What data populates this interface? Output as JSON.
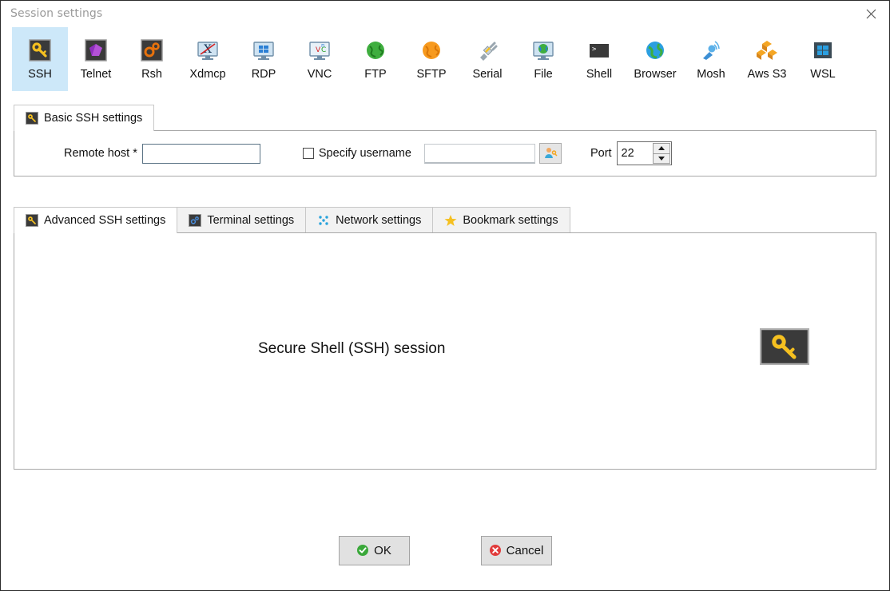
{
  "window": {
    "title": "Session settings",
    "close_label": "Close",
    "close_icon": "close-icon"
  },
  "session_types": [
    {
      "id": "ssh",
      "label": "SSH",
      "icon": "ssh-key-icon",
      "selected": true
    },
    {
      "id": "telnet",
      "label": "Telnet",
      "icon": "telnet-gem-icon",
      "selected": false
    },
    {
      "id": "rsh",
      "label": "Rsh",
      "icon": "rsh-gears-icon",
      "selected": false
    },
    {
      "id": "xdmcp",
      "label": "Xdmcp",
      "icon": "xdmcp-monitor-icon",
      "selected": false
    },
    {
      "id": "rdp",
      "label": "RDP",
      "icon": "rdp-windows-icon",
      "selected": false
    },
    {
      "id": "vnc",
      "label": "VNC",
      "icon": "vnc-monitor-icon",
      "selected": false
    },
    {
      "id": "ftp",
      "label": "FTP",
      "icon": "ftp-globe-icon",
      "selected": false
    },
    {
      "id": "sftp",
      "label": "SFTP",
      "icon": "sftp-globe-icon",
      "selected": false
    },
    {
      "id": "serial",
      "label": "Serial",
      "icon": "serial-plug-icon",
      "selected": false
    },
    {
      "id": "file",
      "label": "File",
      "icon": "file-monitor-icon",
      "selected": false
    },
    {
      "id": "shell",
      "label": "Shell",
      "icon": "shell-prompt-icon",
      "selected": false
    },
    {
      "id": "browser",
      "label": "Browser",
      "icon": "browser-globe-icon",
      "selected": false
    },
    {
      "id": "mosh",
      "label": "Mosh",
      "icon": "mosh-antenna-icon",
      "selected": false
    },
    {
      "id": "awss3",
      "label": "Aws S3",
      "icon": "aws-s3-cubes-icon",
      "selected": false
    },
    {
      "id": "wsl",
      "label": "WSL",
      "icon": "wsl-windows-icon",
      "selected": false
    }
  ],
  "basic_tab": {
    "label": "Basic SSH settings",
    "icon": "ssh-key-icon",
    "active": true
  },
  "basic_fields": {
    "remote_host_label": "Remote host *",
    "remote_host_value": "",
    "remote_host_placeholder": "",
    "specify_username_label": "Specify username",
    "specify_username_checked": false,
    "username_value": "",
    "username_placeholder": "",
    "user_picker_icon": "user-key-icon",
    "port_label": "Port",
    "port_value": "22",
    "spinner_up_icon": "chevron-up-icon",
    "spinner_down_icon": "chevron-down-icon"
  },
  "lower_tabs": [
    {
      "id": "advanced",
      "label": "Advanced SSH settings",
      "icon": "ssh-key-icon",
      "active": true
    },
    {
      "id": "terminal",
      "label": "Terminal settings",
      "icon": "terminal-gear-icon",
      "active": false
    },
    {
      "id": "network",
      "label": "Network settings",
      "icon": "network-nodes-icon",
      "active": false
    },
    {
      "id": "bookmark",
      "label": "Bookmark settings",
      "icon": "star-icon",
      "active": false
    }
  ],
  "content_panel": {
    "description": "Secure Shell (SSH) session",
    "icon": "ssh-key-large-icon"
  },
  "footer": {
    "ok_label": "OK",
    "ok_icon": "check-circle-icon",
    "cancel_label": "Cancel",
    "cancel_icon": "cancel-circle-icon"
  },
  "colors": {
    "selected_tab_bg": "#cde8f9",
    "ok_green": "#3aa83a",
    "cancel_red": "#e13b3b",
    "key_yellow": "#f5c020",
    "panel_border": "#a8a8a8"
  }
}
